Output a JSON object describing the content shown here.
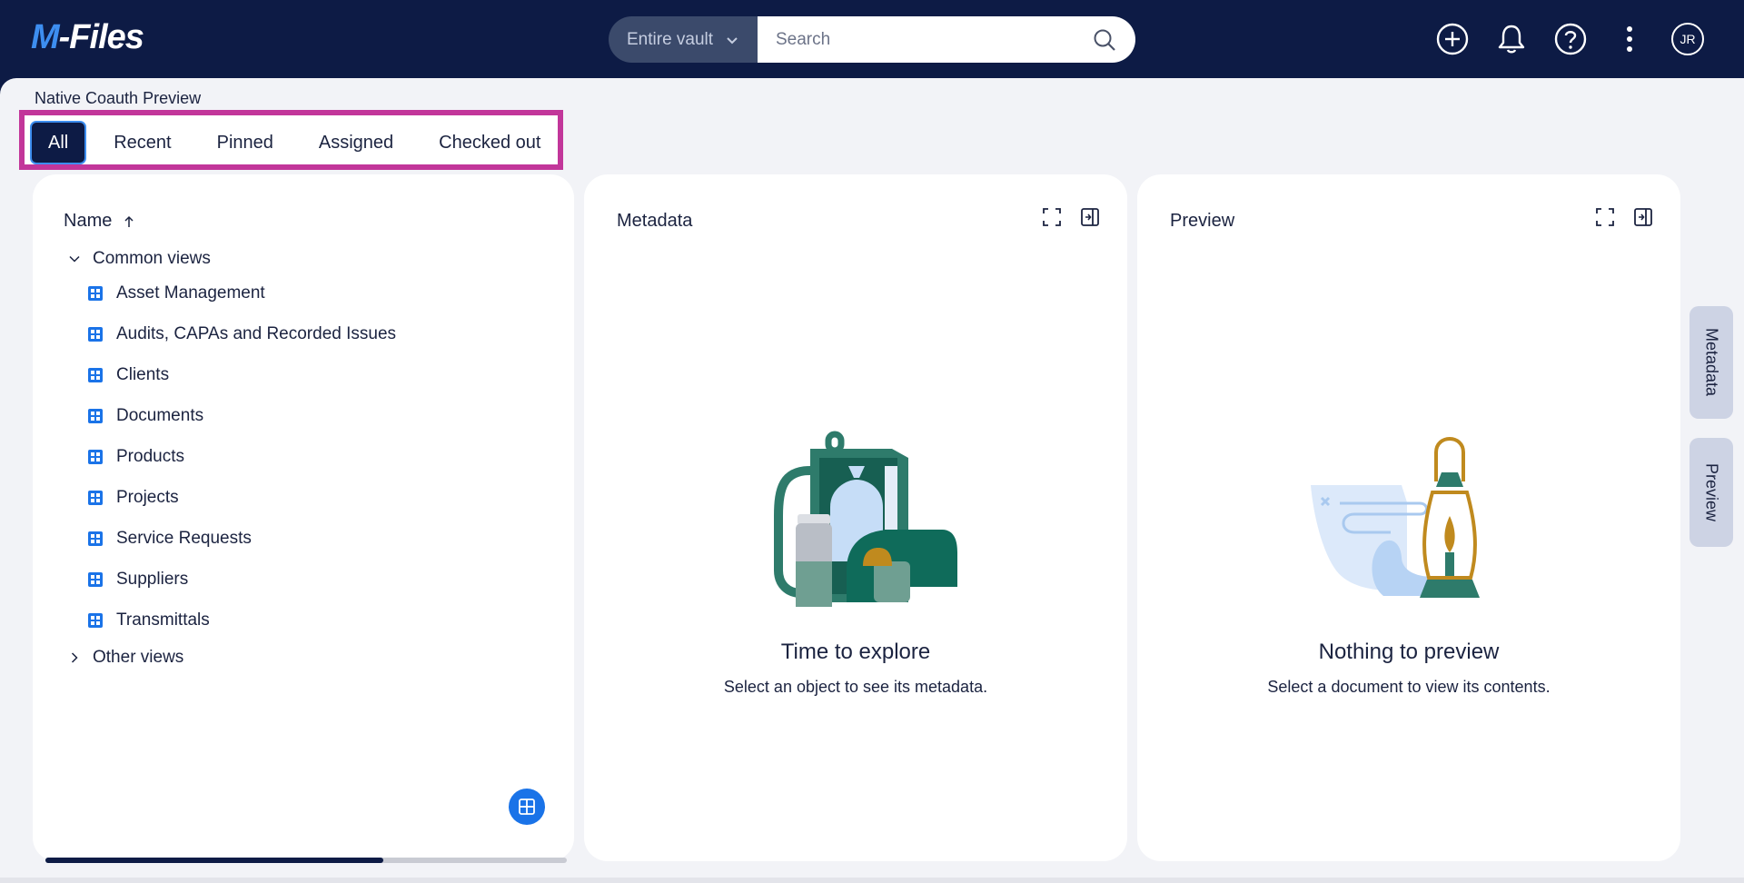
{
  "app": {
    "logo_prefix": "M",
    "logo_suffix": "-Files",
    "vault_name": "Native Coauth Preview"
  },
  "search": {
    "scope": "Entire vault",
    "placeholder": "Search",
    "value": ""
  },
  "header": {
    "avatar_initials": "JR",
    "icons": [
      "add-icon",
      "bell-icon",
      "help-icon",
      "more-icon"
    ]
  },
  "tabs": [
    {
      "label": "All",
      "active": true
    },
    {
      "label": "Recent",
      "active": false
    },
    {
      "label": "Pinned",
      "active": false
    },
    {
      "label": "Assigned",
      "active": false
    },
    {
      "label": "Checked out",
      "active": false
    }
  ],
  "navigation": {
    "column_header": "Name",
    "sort": "ascending",
    "groups": [
      {
        "label": "Common views",
        "expanded": true,
        "items": [
          "Asset Management",
          "Audits, CAPAs and Recorded Issues",
          "Clients",
          "Documents",
          "Products",
          "Projects",
          "Service Requests",
          "Suppliers",
          "Transmittals"
        ]
      },
      {
        "label": "Other views",
        "expanded": false,
        "items": []
      }
    ]
  },
  "metadata_panel": {
    "title": "Metadata",
    "empty_title": "Time to explore",
    "empty_subtitle": "Select an object to see its metadata."
  },
  "preview_panel": {
    "title": "Preview",
    "empty_title": "Nothing to preview",
    "empty_subtitle": "Select a document to view its contents."
  },
  "side_tabs": {
    "metadata": "Metadata",
    "preview": "Preview"
  },
  "colors": {
    "header_bg": "#0d1b45",
    "accent": "#3d8ef0",
    "highlight": "#c2369a",
    "surface": "#f2f3f7"
  }
}
